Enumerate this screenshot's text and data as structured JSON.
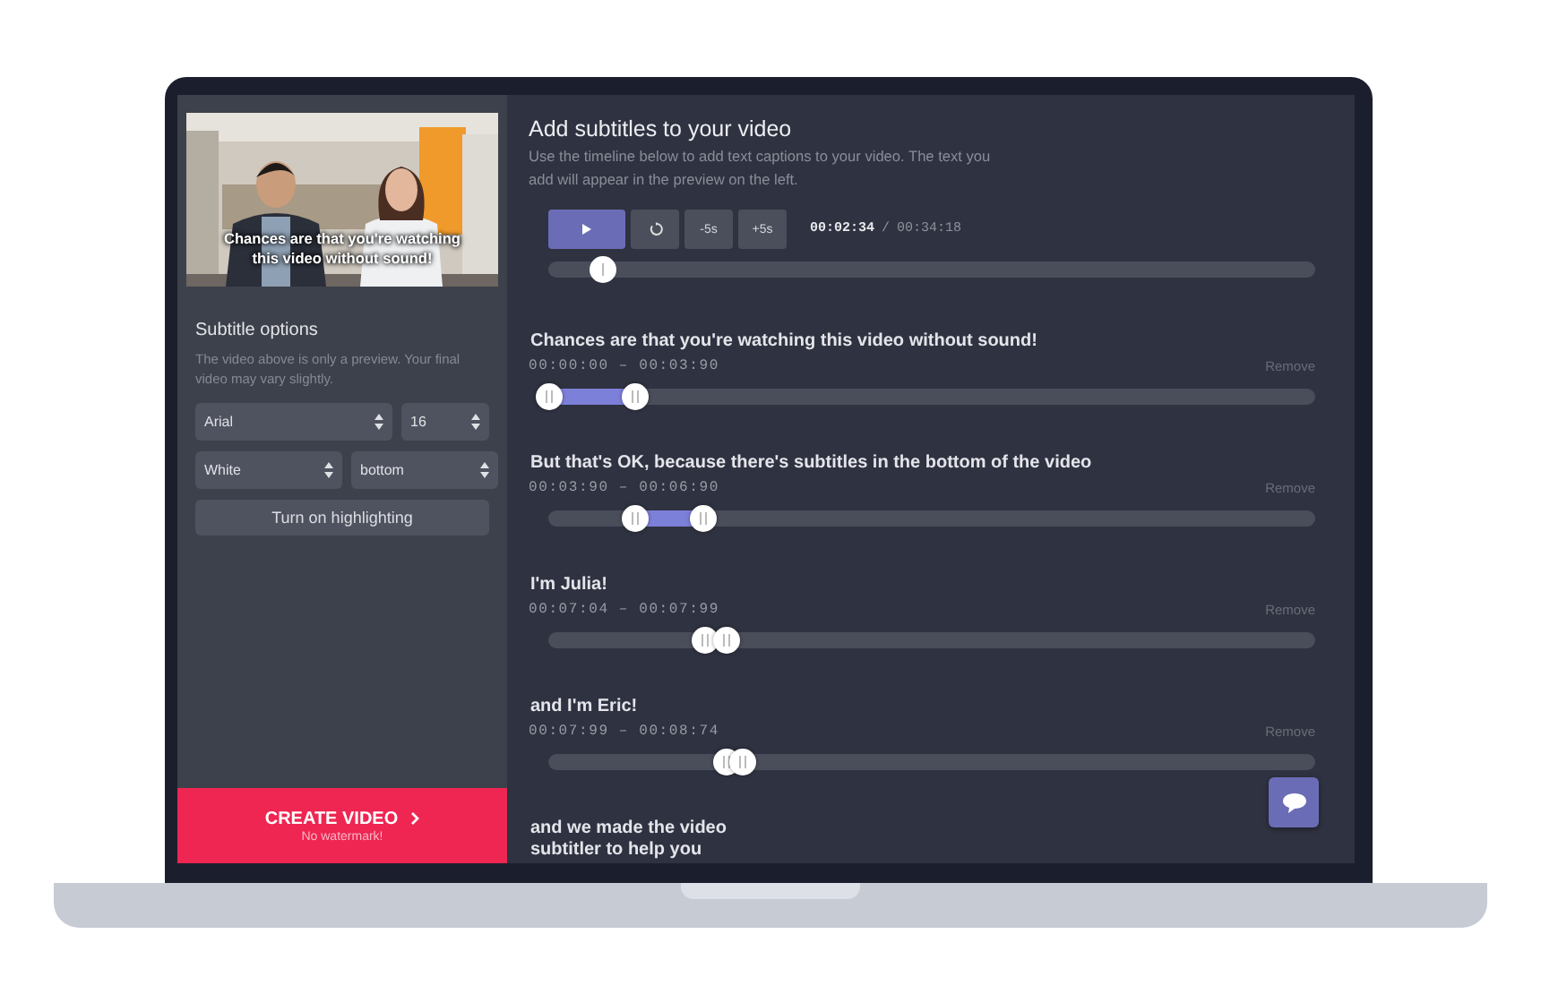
{
  "sidebar": {
    "preview": {
      "kind": "picture",
      "caption": "Chances are that you're watching this video without sound!"
    },
    "options_title": "Subtitle options",
    "options_note": "The video above is only a preview. Your final video may vary slightly.",
    "selects": [
      {
        "value": "Arial"
      },
      {
        "value": "16"
      },
      {
        "value": "White"
      },
      {
        "value": "bottom"
      }
    ],
    "highlight_button": "Turn on highlighting",
    "create_button": {
      "label": "CREATE VIDEO",
      "note": "No watermark!"
    }
  },
  "editor": {
    "title": "Add subtitles to your video",
    "description": "Use the timeline below to add text captions to your video. The text you add will appear in the preview on the left.",
    "controls": [
      {
        "kind": "play"
      },
      {
        "kind": "restart"
      },
      {
        "kind": "text",
        "label": "-5s"
      },
      {
        "kind": "text",
        "label": "+5s"
      }
    ],
    "current_time": "00:02:34",
    "time_separator": "/",
    "total_time": "00:34:18",
    "timeline": {
      "level": 0.07
    },
    "captions": [
      {
        "kind": "timed",
        "text": "Chances are that you're watching this video without sound!",
        "times": "00:00:00 – 00:03:90",
        "remove": "Remove",
        "thumbs": [
          {
            "level": 0
          },
          {
            "level": 0.112
          }
        ]
      },
      {
        "kind": "timed",
        "text": "But that's OK, because there's subtitles in the bottom of the video",
        "times": "00:03:90 – 00:06:90",
        "remove": "Remove",
        "thumbs": [
          {
            "level": 0.112
          },
          {
            "level": 0.2
          }
        ]
      },
      {
        "kind": "timed",
        "text": "I'm Julia!",
        "times": "00:07:04 – 00:07:99",
        "remove": "Remove",
        "thumbs": [
          {
            "level": 0.203
          },
          {
            "level": 0.231
          }
        ]
      },
      {
        "kind": "timed",
        "text": "and I'm Eric!",
        "times": "00:07:99 – 00:08:74",
        "remove": "Remove",
        "thumbs": [
          {
            "level": 0.231
          },
          {
            "level": 0.252
          }
        ]
      },
      {
        "kind": "draft",
        "text": "and we made the video subtitler to help you"
      }
    ]
  }
}
